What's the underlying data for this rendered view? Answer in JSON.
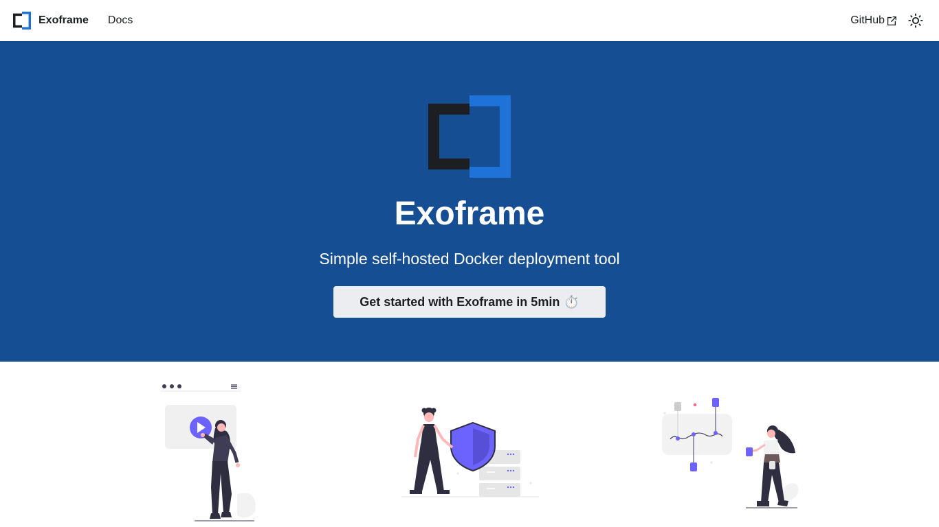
{
  "navbar": {
    "brand_title": "Exoframe",
    "links": [
      {
        "label": "Docs"
      }
    ],
    "github_label": "GitHub",
    "github_icon": "external-link-icon",
    "theme_icon": "sun-icon"
  },
  "hero": {
    "title": "Exoframe",
    "tagline": "Simple self-hosted Docker deployment tool",
    "cta_label": "Get started with Exoframe in 5min",
    "cta_emoji": "⏱️"
  },
  "features": [
    {
      "illustration": "video-player-illustration"
    },
    {
      "illustration": "security-shield-illustration"
    },
    {
      "illustration": "data-analytics-illustration"
    }
  ],
  "colors": {
    "hero_background": "#164e93",
    "logo_dark": "#1c1e21",
    "logo_blue": "#1f73d8",
    "illustration_purple": "#6c63ff"
  }
}
